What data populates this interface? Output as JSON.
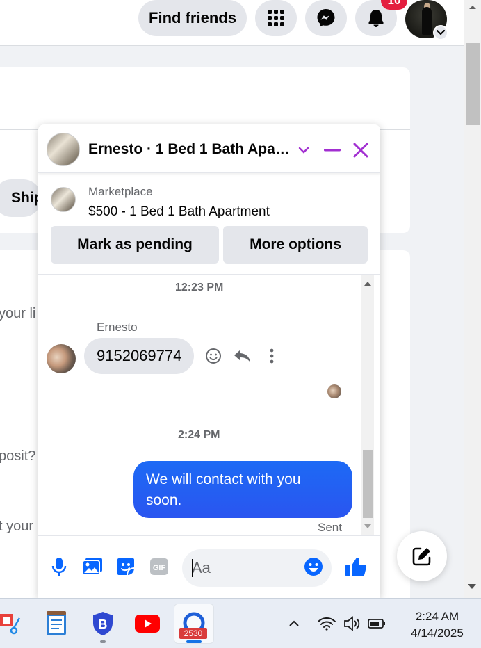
{
  "topbar": {
    "find_friends_label": "Find friends",
    "notifications_badge": "10"
  },
  "background": {
    "ship_label": "Ship",
    "text_line_1": "your li",
    "text_line_2": "posit?",
    "text_line_3": "t your"
  },
  "chat": {
    "title": "Ernesto · 1 Bed 1 Bath Apartment",
    "marketplace_label": "Marketplace",
    "listing_title": "$500 - 1 Bed 1 Bath Apartment",
    "mark_pending_label": "Mark as pending",
    "more_options_label": "More options",
    "messages": {
      "timestamp_1": "12:23 PM",
      "sender_name": "Ernesto",
      "incoming_text": "9152069774",
      "timestamp_2": "2:24 PM",
      "outgoing_text": "We will contact with you soon.",
      "sent_status": "Sent"
    },
    "composer": {
      "placeholder": "Aa"
    }
  },
  "taskbar": {
    "app_badge_count": "2530",
    "time": "2:24 AM",
    "date": "4/14/2025"
  },
  "colors": {
    "accent_purple": "#a22fd1",
    "messenger_blue": "#0866ff",
    "bubble_gray": "#e4e6eb",
    "notification_red": "#e41e3f"
  }
}
